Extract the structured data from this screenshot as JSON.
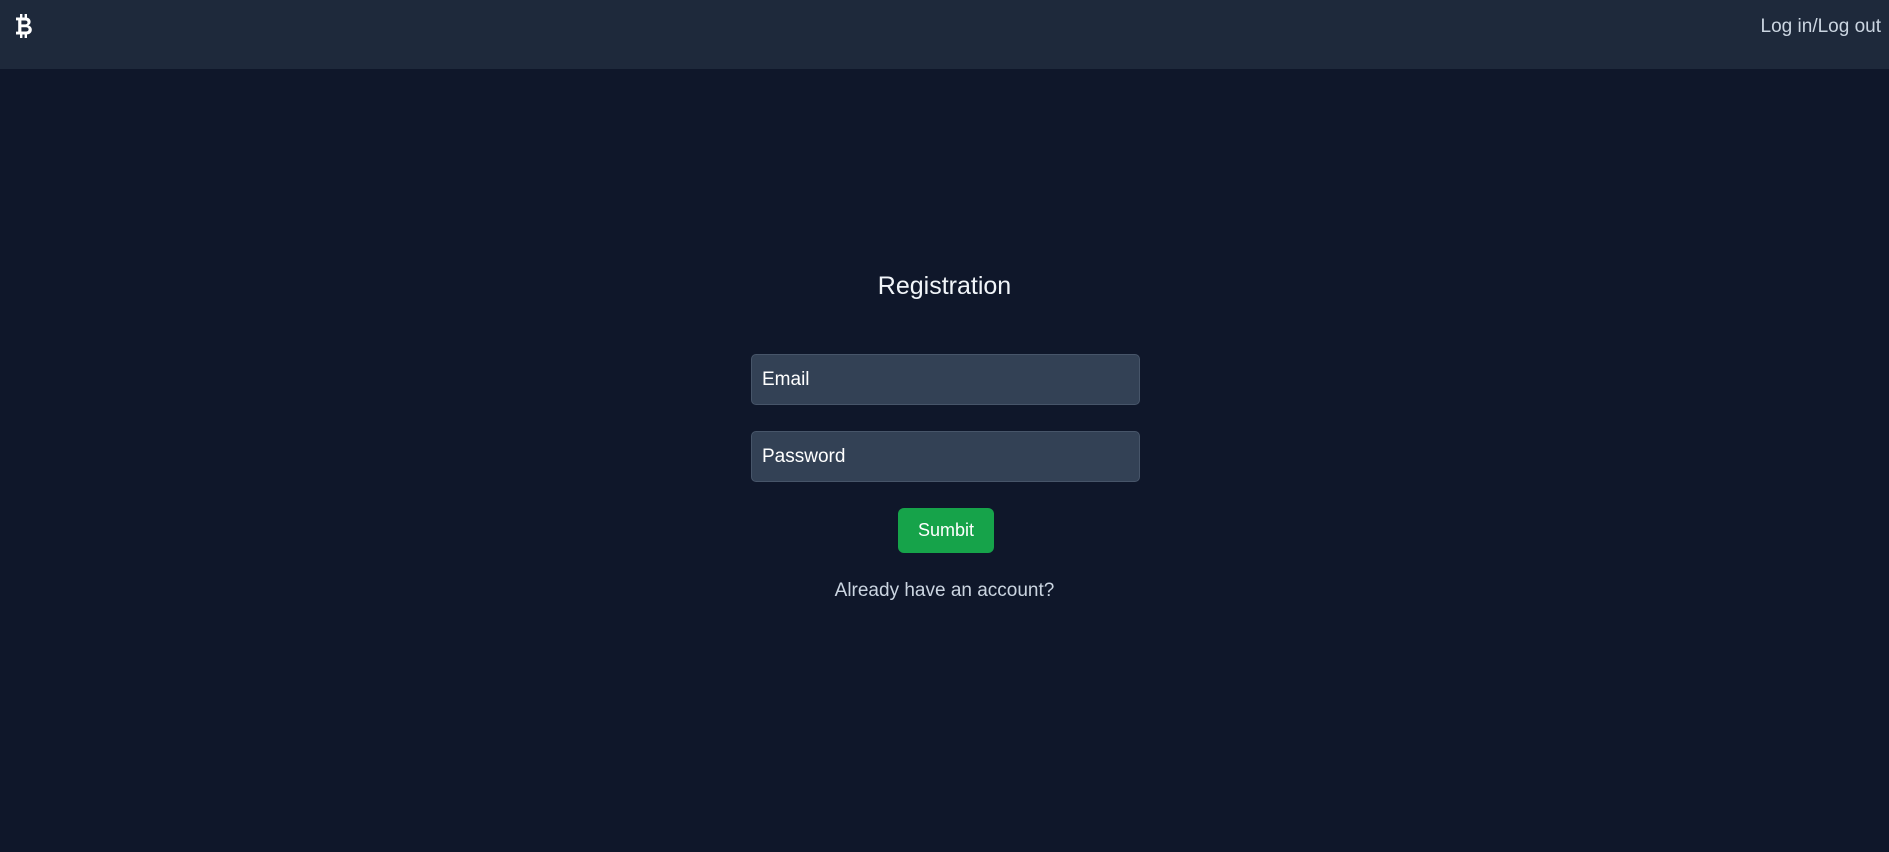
{
  "navbar": {
    "brand_icon": "bitcoin-icon",
    "auth_link_label": "Log in/Log out"
  },
  "form": {
    "title": "Registration",
    "email_placeholder": "Email",
    "email_value": "",
    "password_placeholder": "Password",
    "password_value": "",
    "submit_label": "Sumbit",
    "account_link_label": "Already have an account?"
  },
  "colors": {
    "page_background": "#0f172a",
    "navbar_background": "#1e293b",
    "input_background": "#334155",
    "submit_background": "#16a34a"
  }
}
